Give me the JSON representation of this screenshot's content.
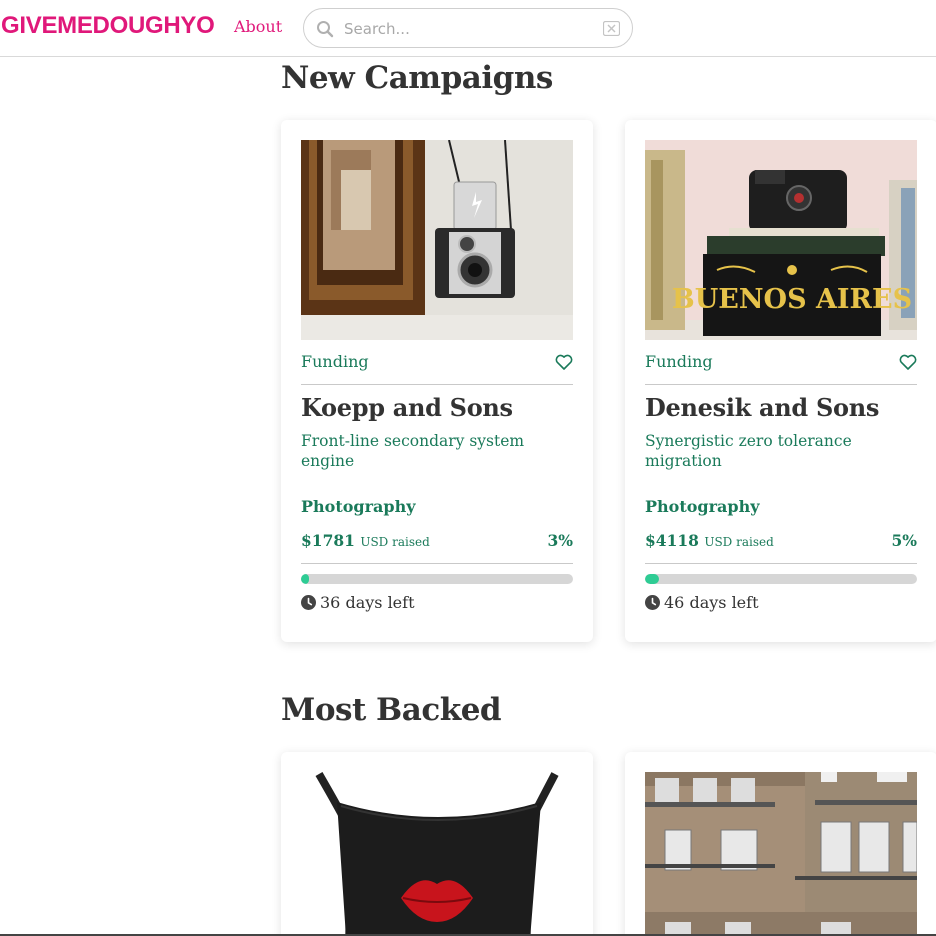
{
  "header": {
    "logo": "GIVEMEDOUGHYO",
    "about_label": "About",
    "search_placeholder": "Search..."
  },
  "sections": {
    "new_campaigns_title": "New Campaigns",
    "most_backed_title": "Most Backed"
  },
  "new_campaigns": [
    {
      "status": "Funding",
      "title": "Koepp and Sons",
      "description": "Front-line secondary system engine",
      "category": "Photography",
      "amount": "$1781",
      "currency_label": "USD raised",
      "percent": "3%",
      "progress": 0.03,
      "days_left": "36 days left"
    },
    {
      "status": "Funding",
      "title": "Denesik and Sons",
      "description": "Synergistic zero tolerance migration",
      "category": "Photography",
      "amount": "$4118",
      "currency_label": "USD raised",
      "percent": "5%",
      "progress": 0.05,
      "days_left": "46 days left"
    }
  ],
  "buenos_aires_sign": "BUENOS AIRES",
  "colors": {
    "brand": "#e0187a",
    "accent_green": "#1a7a5a",
    "progress_fill": "#2ecc94"
  }
}
